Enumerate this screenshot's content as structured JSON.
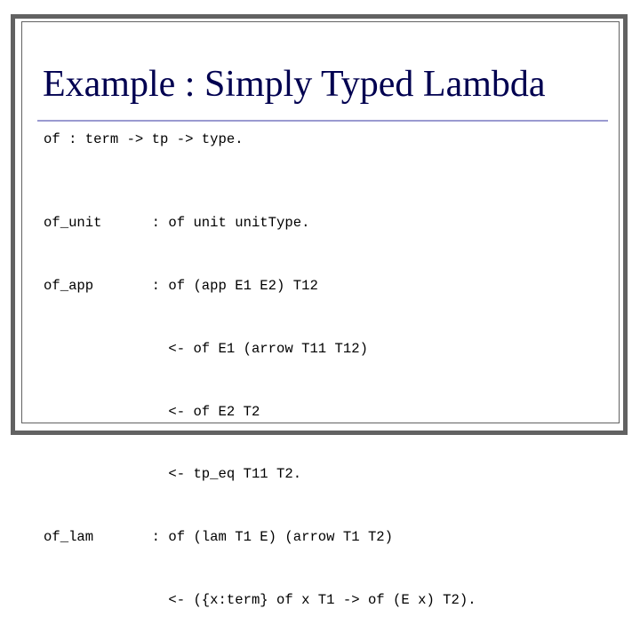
{
  "slide": {
    "title": "Example : Simply Typed Lambda",
    "signature": "of : term -> tp -> type.",
    "rules": [
      "of_unit      : of unit unitType.",
      "of_app       : of (app E1 E2) T12",
      "               <- of E1 (arrow T11 T12)",
      "               <- of E2 T2",
      "               <- tp_eq T11 T2.",
      "of_lam       : of (lam T1 E) (arrow T1 T2)",
      "               <- ({x:term} of x T1 -> of (E x) T2)."
    ]
  },
  "colors": {
    "title": "#000050",
    "divider": "#9a9ad0",
    "frame": "#626262"
  }
}
